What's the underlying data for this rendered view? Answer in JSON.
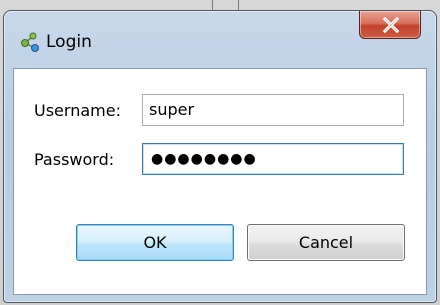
{
  "window": {
    "title": "Login",
    "icon": "share-network-icon",
    "close_icon": "close-icon"
  },
  "form": {
    "username_label": "Username:",
    "username_value": "super",
    "password_label": "Password:",
    "password_mask": "●●●●●●●●"
  },
  "buttons": {
    "ok_label": "OK",
    "cancel_label": "Cancel"
  },
  "colors": {
    "frame": "#bdd0e4",
    "close_button": "#c2412b",
    "focus_border": "#3d7bad",
    "ok_button": "#bee6fd"
  }
}
